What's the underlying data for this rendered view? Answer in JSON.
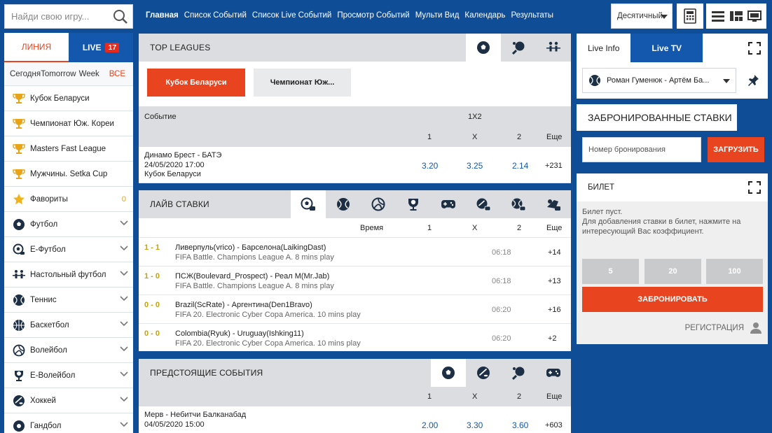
{
  "search": {
    "placeholder": "Найди свою игру..."
  },
  "nav": [
    "Главная",
    "Список Событий",
    "Список Live Событий",
    "Просмотр Событий",
    "Мульти Вид",
    "Календарь",
    "Результаты"
  ],
  "odds_format": "Десятичный",
  "sidebar": {
    "tab_line": "ЛИНИЯ",
    "tab_live": "LIVE",
    "live_count": "17",
    "filters": [
      "Сегодня",
      "Tomorrow",
      "Week"
    ],
    "filter_all": "ВСЕ",
    "items": [
      {
        "label": "Кубок Беларуси",
        "icon": "trophy-icon"
      },
      {
        "label": "Чемпионат Юж. Кореи",
        "icon": "trophy-icon"
      },
      {
        "label": "Masters Fast League",
        "icon": "trophy-icon"
      },
      {
        "label": "Мужчины. Setka Cup",
        "icon": "trophy-icon"
      },
      {
        "label": "Фавориты",
        "icon": "star-icon",
        "count": "0"
      },
      {
        "label": "Футбол",
        "icon": "soccer-icon"
      },
      {
        "label": "E-Футбол",
        "icon": "esoccer-icon"
      },
      {
        "label": "Настольный футбол",
        "icon": "table-soccer-icon"
      },
      {
        "label": "Теннис",
        "icon": "tennis-icon"
      },
      {
        "label": "Баскетбол",
        "icon": "basketball-icon"
      },
      {
        "label": "Волейбол",
        "icon": "volleyball-icon"
      },
      {
        "label": "E-Волейбол",
        "icon": "evolleyball-icon"
      },
      {
        "label": "Хоккей",
        "icon": "hockey-icon"
      },
      {
        "label": "Гандбол",
        "icon": "handball-icon"
      }
    ]
  },
  "top_leagues": {
    "title": "TOP LEAGUES",
    "leagues": [
      "Кубок Беларуси",
      "Чемпионат Юж..."
    ],
    "col_event": "Событие",
    "col_market": "1X2",
    "cols": [
      "1",
      "X",
      "2",
      "Еще"
    ],
    "event": {
      "name": "Динамо Брест - БАТЭ",
      "date": "24/05/2020 17:00",
      "league": "Кубок Беларуси",
      "o1": "3.20",
      "ox": "3.25",
      "o2": "2.14",
      "more": "+231"
    }
  },
  "live": {
    "title": "ЛАЙВ СТАВКИ",
    "col_time": "Время",
    "cols": [
      "1",
      "X",
      "2",
      "Еще"
    ],
    "rows": [
      {
        "score": "1 - 1",
        "name": "Ливерпуль(vrico) - Барселона(LaikingDast)",
        "league": "FIFA Battle. Champions League A. 8 mins play",
        "time": "06:18",
        "more": "+14"
      },
      {
        "score": "1 - 0",
        "name": "ПСЖ(Boulevard_Prospect) - Реал М(Mr.Jab)",
        "league": "FIFA Battle. Champions League A. 8 mins play",
        "time": "06:18",
        "more": "+13"
      },
      {
        "score": "0 - 0",
        "name": "Brazil(ScRate) - Аргентина(Den1Bravo)",
        "league": "FIFA 20. Electronic Cyber Copa America. 10 mins play",
        "time": "06:20",
        "more": "+16"
      },
      {
        "score": "0 - 0",
        "name": "Colombia(Ryuk) - Uruguay(Ishking11)",
        "league": "FIFA 20. Electronic Cyber Copa America. 10 mins play",
        "time": "06:20",
        "more": "+2"
      }
    ]
  },
  "upcoming": {
    "title": "ПРЕДСТОЯЩИЕ СОБЫТИЯ",
    "cols": [
      "1",
      "X",
      "2",
      "Еще"
    ],
    "event": {
      "name": "Мерв - Небитчи Балканабад",
      "date": "04/05/2020 15:00",
      "o1": "2.00",
      "ox": "3.30",
      "o2": "3.60",
      "more": "+603"
    }
  },
  "right": {
    "tab_info": "Live Info",
    "tab_tv": "Live TV",
    "match": "Роман Гуменюк - Артём Ба...",
    "booked_title": "ЗАБРОНИРОВАННЫЕ СТАВКИ",
    "booking_placeholder": "Номер бронирования",
    "load_label": "ЗАГРУЗИТЬ",
    "ticket_title": "БИЛЕТ",
    "ticket_msg": "Билет пуст.\nДля добавления ставки в билет, нажмите на интересующий Вас коэффициент.",
    "stakes": [
      "5",
      "20",
      "100"
    ],
    "book_label": "ЗАБРОНИРОВАТЬ",
    "register_label": "РЕГИСТРАЦИЯ"
  },
  "colors": {
    "brand_blue": "#0f4d96",
    "accent_orange": "#e8441f",
    "odd_blue": "#1458ad",
    "score_yellow": "#c6a400"
  }
}
